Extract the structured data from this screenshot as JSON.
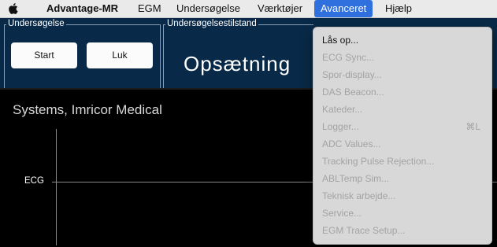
{
  "menubar": {
    "app_name": "Advantage-MR",
    "items": [
      "EGM",
      "Undersøgelse",
      "Værktøjer",
      "Avanceret",
      "Hjælp"
    ],
    "active_item": "Avanceret"
  },
  "panel": {
    "exam_group_label": "Undersøgelse",
    "start_button": "Start",
    "close_button": "Luk",
    "state_group_label": "Undersøgelsestilstand",
    "state_value": "Opsætning"
  },
  "content": {
    "title": "Systems, Imricor Medical",
    "ecg_label": "ECG"
  },
  "dropdown": {
    "items": [
      {
        "label": "Lås op...",
        "enabled": true
      },
      {
        "label": "ECG Sync...",
        "enabled": false
      },
      {
        "label": "Spor-display...",
        "enabled": false
      },
      {
        "label": "DAS Beacon...",
        "enabled": false
      },
      {
        "label": "Kateder...",
        "enabled": false
      },
      {
        "label": "Logger...",
        "enabled": false,
        "shortcut": "⌘L"
      },
      {
        "label": "ADC Values...",
        "enabled": false
      },
      {
        "label": "Tracking Pulse Rejection...",
        "enabled": false
      },
      {
        "label": "ABLTemp Sim...",
        "enabled": false
      },
      {
        "label": "Teknisk arbejde...",
        "enabled": false
      },
      {
        "label": "Service...",
        "enabled": false
      },
      {
        "label": "EGM Trace Setup...",
        "enabled": false
      }
    ]
  },
  "colors": {
    "menu_highlight": "#2f6fde",
    "panel_background": "#082a48",
    "disabled_text": "#a3a3a3"
  },
  "icons": {
    "apple": "apple-logo-icon"
  }
}
